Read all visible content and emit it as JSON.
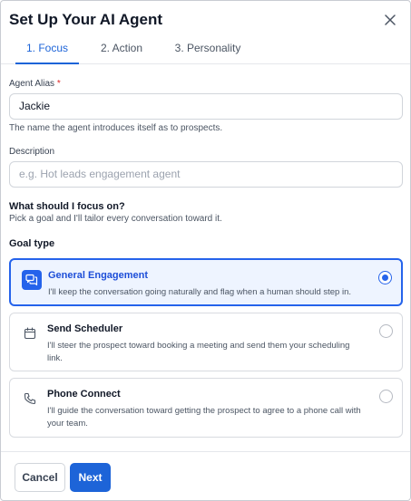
{
  "dialog": {
    "title": "Set Up Your AI Agent",
    "close_icon": "close-icon"
  },
  "tabs": [
    {
      "label": "1. Focus",
      "active": true
    },
    {
      "label": "2. Action",
      "active": false
    },
    {
      "label": "3. Personality",
      "active": false
    }
  ],
  "alias": {
    "label": "Agent Alias",
    "required_mark": "*",
    "value": "Jackie",
    "help": "The name the agent introduces itself as to prospects."
  },
  "description": {
    "label": "Description",
    "placeholder": "e.g. Hot leads engagement agent"
  },
  "focus": {
    "title": "What should I focus on?",
    "subtitle": "Pick a goal and I'll tailor every conversation toward it."
  },
  "goal_type": {
    "label": "Goal type",
    "options": [
      {
        "title": "General Engagement",
        "desc": "I'll keep the conversation going naturally and flag when a human should step in.",
        "icon": "chat-bubbles-icon",
        "selected": true
      },
      {
        "title": "Send Scheduler",
        "desc": "I'll steer the prospect toward booking a meeting and send them your scheduling link.",
        "icon": "calendar-icon",
        "selected": false
      },
      {
        "title": "Phone Connect",
        "desc": "I'll guide the conversation toward getting the prospect to agree to a phone call with your team.",
        "icon": "phone-icon",
        "selected": false
      }
    ]
  },
  "footer": {
    "cancel_label": "Cancel",
    "next_label": "Next"
  },
  "colors": {
    "accent": "#1d64d8",
    "selected_bg": "#eef4ff",
    "required": "#dc2626"
  }
}
